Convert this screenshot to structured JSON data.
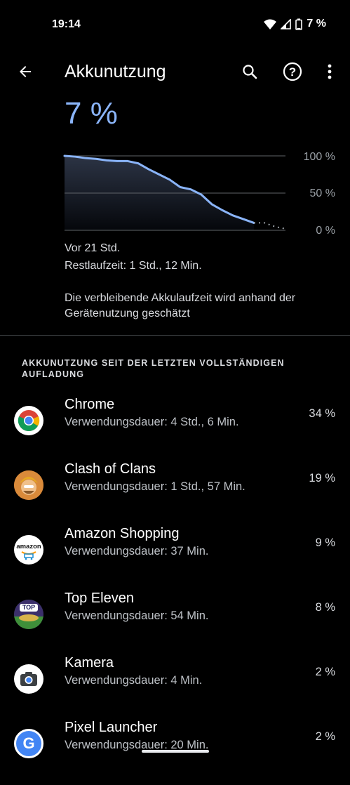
{
  "status_bar": {
    "time": "19:14",
    "battery_text": "7 %"
  },
  "header": {
    "title": "Akkunutzung"
  },
  "battery": {
    "level_text": "7 %",
    "level_value": 7
  },
  "chart_data": {
    "type": "area",
    "y_ticks": [
      "100 %",
      "50 %",
      "0 %"
    ],
    "ylim": [
      0,
      100
    ],
    "series": [
      {
        "values": [
          100,
          99,
          97,
          96,
          94,
          93,
          93,
          90,
          82,
          75,
          68,
          58,
          55,
          48,
          35,
          27,
          20,
          15,
          10
        ]
      }
    ],
    "projection": [
      10,
      5,
      2
    ]
  },
  "info": {
    "since": "Vor 21 Std.",
    "remaining": "Restlaufzeit: 1 Std., 12 Min.",
    "estimate_note": "Die verbleibende Akkulaufzeit wird anhand der Gerätenutzung geschätzt"
  },
  "section": {
    "title": "AKKUNUTZUNG SEIT DER LETZTEN VOLLSTÄNDIGEN AUFLADUNG"
  },
  "apps": [
    {
      "name": "Chrome",
      "usage": "Verwendungsdauer: 4 Std., 6 Min.",
      "percent": "34 %",
      "icon": "chrome-icon"
    },
    {
      "name": "Clash of Clans",
      "usage": "Verwendungsdauer: 1 Std., 57 Min.",
      "percent": "19 %",
      "icon": "clash-of-clans-icon"
    },
    {
      "name": "Amazon Shopping",
      "usage": "Verwendungsdauer: 37 Min.",
      "percent": "9 %",
      "icon": "amazon-icon",
      "icon_text": "amazon"
    },
    {
      "name": "Top Eleven",
      "usage": "Verwendungsdauer: 54 Min.",
      "percent": "8 %",
      "icon": "top-eleven-icon",
      "icon_text": "TOP"
    },
    {
      "name": "Kamera",
      "usage": "Verwendungsdauer: 4 Min.",
      "percent": "2 %",
      "icon": "camera-icon"
    },
    {
      "name": "Pixel Launcher",
      "usage": "Verwendungsdauer: 20 Min.",
      "percent": "2 %",
      "icon": "pixel-launcher-icon",
      "icon_text": "G"
    }
  ],
  "colors": {
    "accent": "#8ab4f8",
    "background": "#000000"
  }
}
